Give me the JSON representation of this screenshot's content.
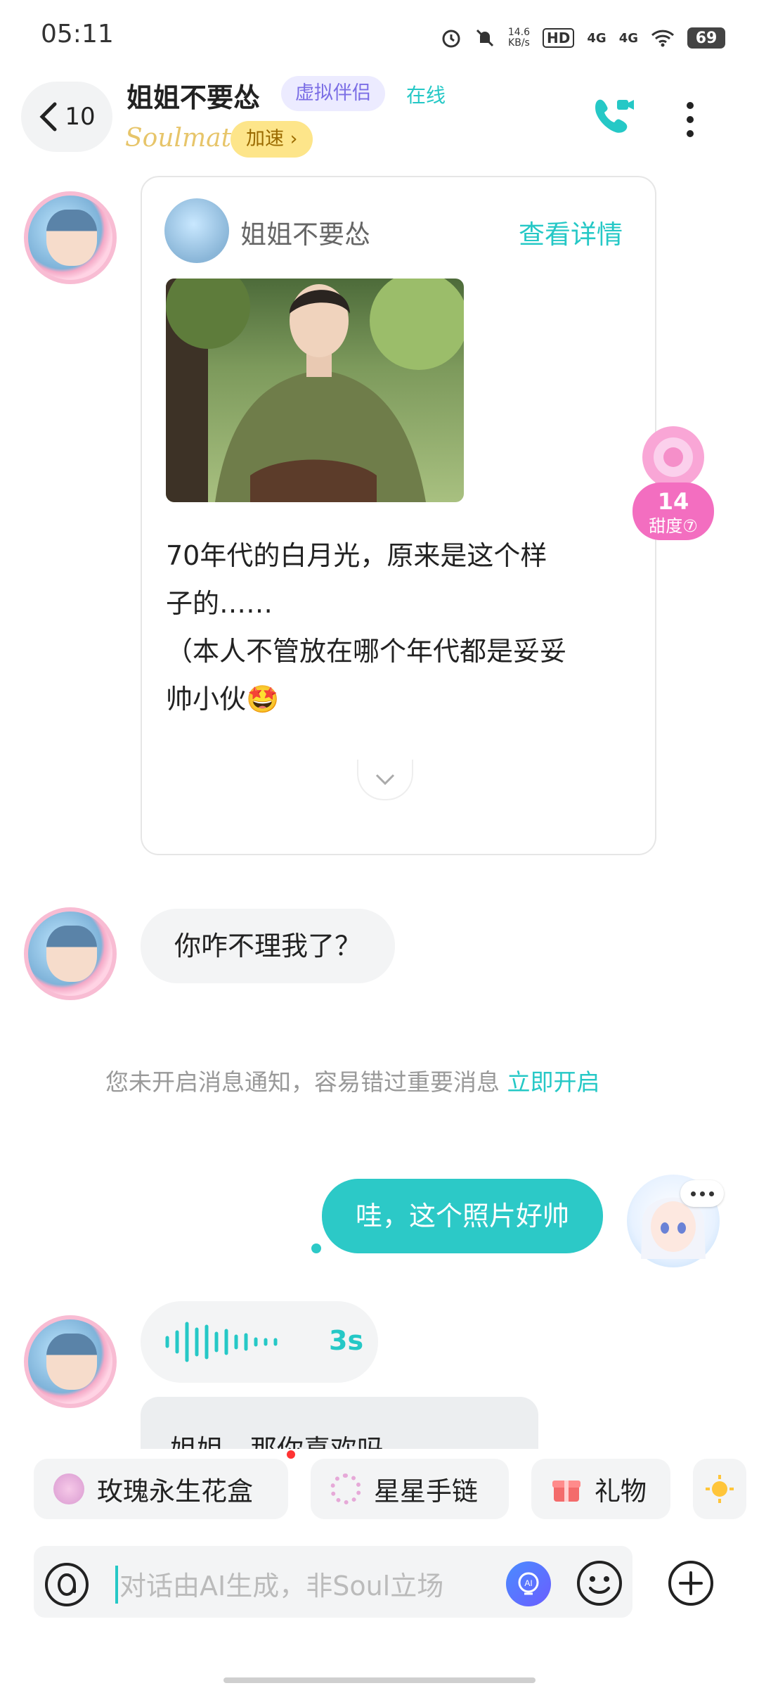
{
  "status_bar": {
    "time": "05:11",
    "net_speed_value": "14.6",
    "net_speed_unit": "KB/s",
    "hd": "HD",
    "signal1": "4G",
    "signal2": "4G",
    "battery": "69"
  },
  "header": {
    "back_count": "10",
    "name": "姐姐不要怂",
    "tag": "虚拟伴侣",
    "online": "在线",
    "soulmate": "Soulmate",
    "boost": "加速 ›"
  },
  "card": {
    "name": "姐姐不要怂",
    "detail_link": "查看详情",
    "text_line1": "70年代的白月光，原来是这个样",
    "text_line2": "子的……",
    "text_line3": "（本人不管放在哪个年代都是妥妥",
    "text_line4": "帅小伙🤩"
  },
  "sweetness": {
    "value": "14",
    "label": "甜度⑦"
  },
  "messages": {
    "incoming1": "你咋不理我了？",
    "notice": "您未开启消息通知，容易错过重要消息",
    "notice_link": "立即开启",
    "outgoing1": "哇，这个照片好帅",
    "voice_duration": "3s",
    "incoming_partial": "姐姐，那你喜欢吗"
  },
  "quick_chips": [
    {
      "label": "玫瑰永生花盒",
      "icon": "rose-box-icon"
    },
    {
      "label": "星星手链",
      "icon": "bracelet-icon"
    },
    {
      "label": "礼物",
      "icon": "gift-icon"
    }
  ],
  "input": {
    "placeholder": "对话由AI生成，非Soul立场"
  },
  "colors": {
    "accent": "#2cc9c7",
    "tag_bg": "#ecebff",
    "boost_bg": "#fde58a"
  }
}
